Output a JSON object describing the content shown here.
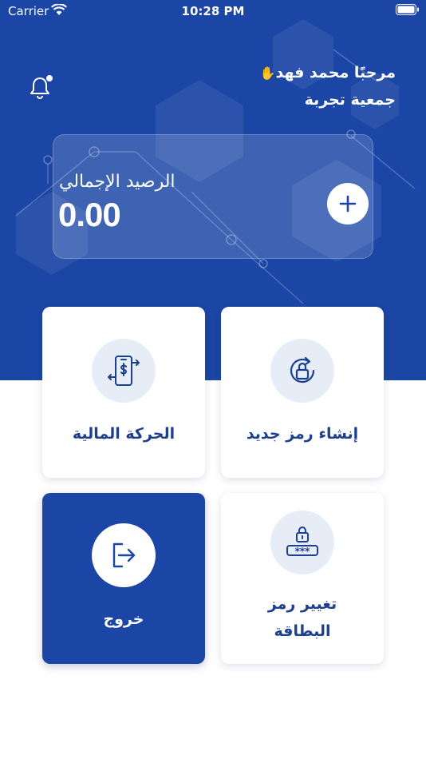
{
  "status_bar": {
    "carrier": "Carrier",
    "time": "10:28 PM"
  },
  "header": {
    "greeting": "مرحبًا محمد فهد",
    "greeting_emoji": "✋",
    "organization": "جمعية تجربة",
    "notification_icon": "bell-icon"
  },
  "balance": {
    "label": "الرصيد الإجمالي",
    "value": "0.00",
    "add_icon": "plus-icon"
  },
  "tiles": [
    {
      "label": "الحركة المالية",
      "icon": "transfer-phone-icon"
    },
    {
      "label": "إنشاء رمز جديد",
      "icon": "refresh-lock-icon"
    },
    {
      "label": "خروج",
      "icon": "logout-icon"
    },
    {
      "label": "تغيير رمز البطاقة",
      "icon": "pin-lock-icon"
    }
  ],
  "colors": {
    "brand_blue": "#1b46a5",
    "tile_text": "#1d3f8f",
    "icon_bg": "#e7edf7"
  }
}
